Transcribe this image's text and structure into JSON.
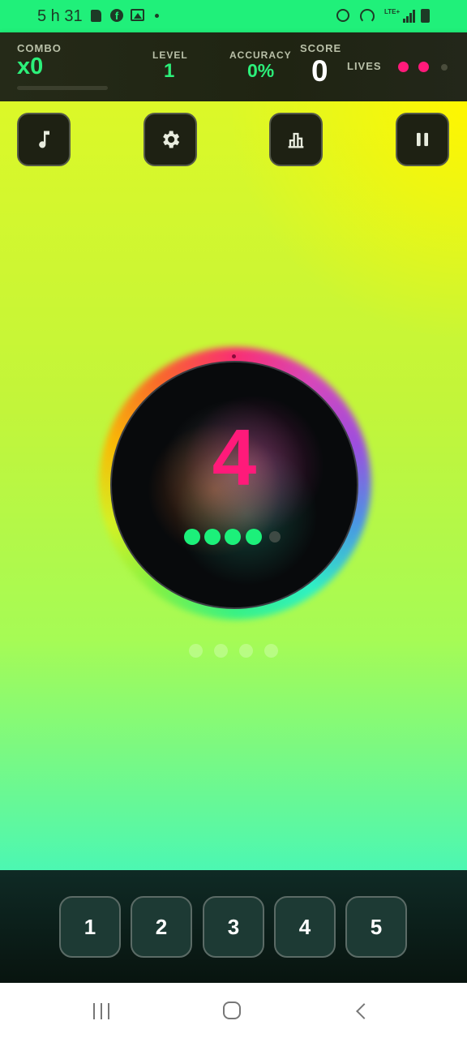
{
  "status_bar": {
    "time": "5 h 31",
    "icons": [
      "sd-card-icon",
      "facebook-icon",
      "gallery-icon",
      "dot-icon",
      "alarm-icon",
      "hotspot-icon",
      "lte-icon",
      "signal-icon",
      "battery-icon"
    ],
    "lte_text": "LTE+"
  },
  "hud": {
    "combo_label": "COMBO",
    "combo_value": "x0",
    "level_label": "LEVEL",
    "level_value": "1",
    "accuracy_label": "ACCURACY",
    "accuracy_value": "0%",
    "score_label": "SCORE",
    "score_value": "0",
    "lives_label": "LIVES",
    "lives_total": 3,
    "lives_remaining": 2,
    "combo_progress": 0
  },
  "controls": {
    "icons": [
      "music-note-icon",
      "gear-icon",
      "bar-chart-icon",
      "pause-icon"
    ]
  },
  "target": {
    "number": "4",
    "pips_total": 5,
    "pips_filled": 4,
    "sequence_dots": 4
  },
  "keypad": {
    "keys": [
      "1",
      "2",
      "3",
      "4",
      "5"
    ]
  },
  "colors": {
    "accent_green": "#2cf07a",
    "accent_pink": "#ff1a7a",
    "status_bar": "#20f07a"
  }
}
